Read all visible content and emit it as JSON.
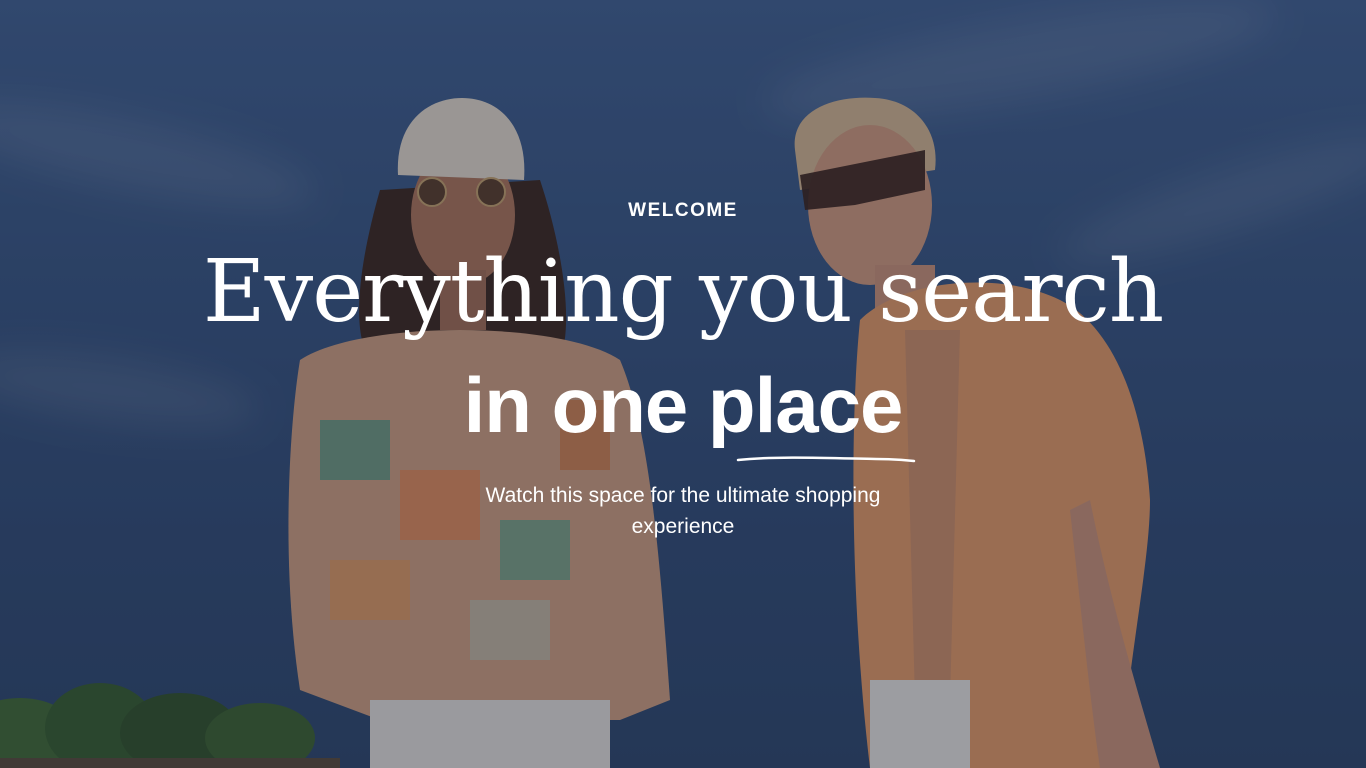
{
  "hero": {
    "eyebrow": "WELCOME",
    "headline_line1": "Everything you search",
    "headline_line2": "in one place",
    "subtitle": "Watch this space for the ultimate shopping experience"
  },
  "colors": {
    "sky": "#3a5a88",
    "overlay": "#1a223a",
    "text": "#ffffff",
    "shirt_orange": "#e99a5e",
    "shirt_pattern": "#d98b58"
  },
  "icons": [
    "hand-drawn-underline-icon"
  ]
}
